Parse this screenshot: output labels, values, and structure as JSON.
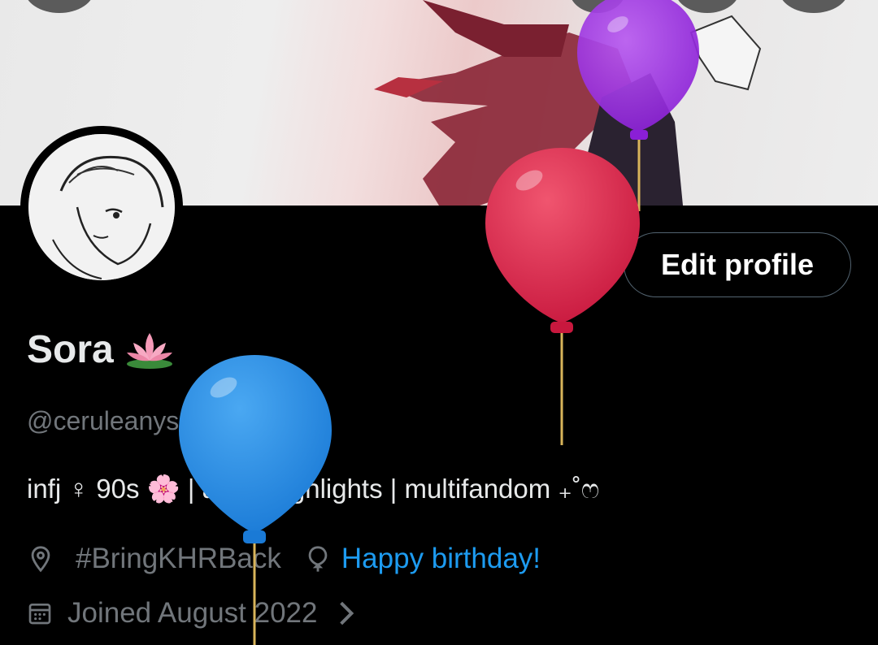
{
  "profile": {
    "name": "Sora",
    "name_emoji": "lotus",
    "handle": "@ceruleanys",
    "bio": "infj ♀ 90s 🌸 | art in highlights | multifandom ₊˚ෆ",
    "location": "#BringKHRBack",
    "birthday_text": "Happy birthday!",
    "joined": "Joined August 2022"
  },
  "actions": {
    "edit_profile": "Edit profile"
  },
  "icons": {
    "location": "location-pin-icon",
    "birthday": "balloon-outline-icon",
    "joined": "calendar-icon",
    "more": "chevron-right-icon"
  },
  "colors": {
    "background": "#000000",
    "text_primary": "#e7e9ea",
    "text_secondary": "#71767b",
    "link": "#1d9bf0",
    "balloon_purple": "#9b30e0",
    "balloon_red": "#e0305a",
    "balloon_blue": "#2a8be0"
  }
}
